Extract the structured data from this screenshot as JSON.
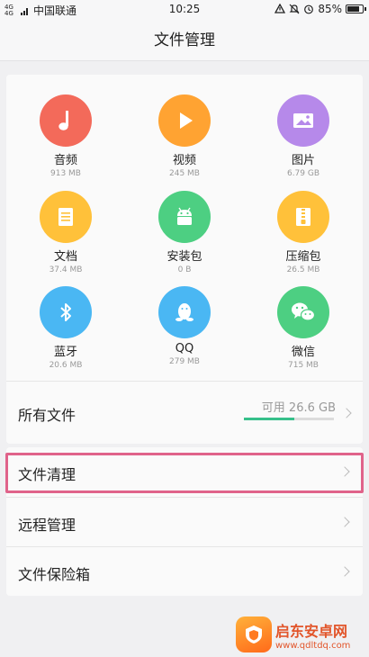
{
  "status_bar": {
    "network": "4G 4G",
    "carrier": "中国联通",
    "time": "10:25",
    "battery": "85%",
    "battery_level": 0.85
  },
  "header": {
    "title": "文件管理"
  },
  "categories": [
    {
      "name": "音频",
      "size": "913 MB",
      "icon": "music-note-icon",
      "color": "#f36a5a"
    },
    {
      "name": "视频",
      "size": "245 MB",
      "icon": "play-icon",
      "color": "#ffa332"
    },
    {
      "name": "图片",
      "size": "6.79 GB",
      "icon": "picture-icon",
      "color": "#b689ea"
    },
    {
      "name": "文档",
      "size": "37.4 MB",
      "icon": "document-icon",
      "color": "#ffc13a"
    },
    {
      "name": "安装包",
      "size": "0 B",
      "icon": "android-icon",
      "color": "#4dcf82"
    },
    {
      "name": "压缩包",
      "size": "26.5 MB",
      "icon": "archive-icon",
      "color": "#ffc13a"
    },
    {
      "name": "蓝牙",
      "size": "20.6 MB",
      "icon": "bluetooth-icon",
      "color": "#4ab7f3"
    },
    {
      "name": "QQ",
      "size": "279 MB",
      "icon": "qq-icon",
      "color": "#4ab7f3"
    },
    {
      "name": "微信",
      "size": "715 MB",
      "icon": "wechat-icon",
      "color": "#4dcf82"
    }
  ],
  "all_files": {
    "label": "所有文件",
    "available": "可用 26.6 GB",
    "used_fraction": 0.56
  },
  "list": [
    {
      "label": "文件清理"
    },
    {
      "label": "远程管理"
    },
    {
      "label": "文件保险箱"
    }
  ],
  "watermark": {
    "line1": "启东安卓网",
    "line2": "www.qdltdq.com"
  }
}
